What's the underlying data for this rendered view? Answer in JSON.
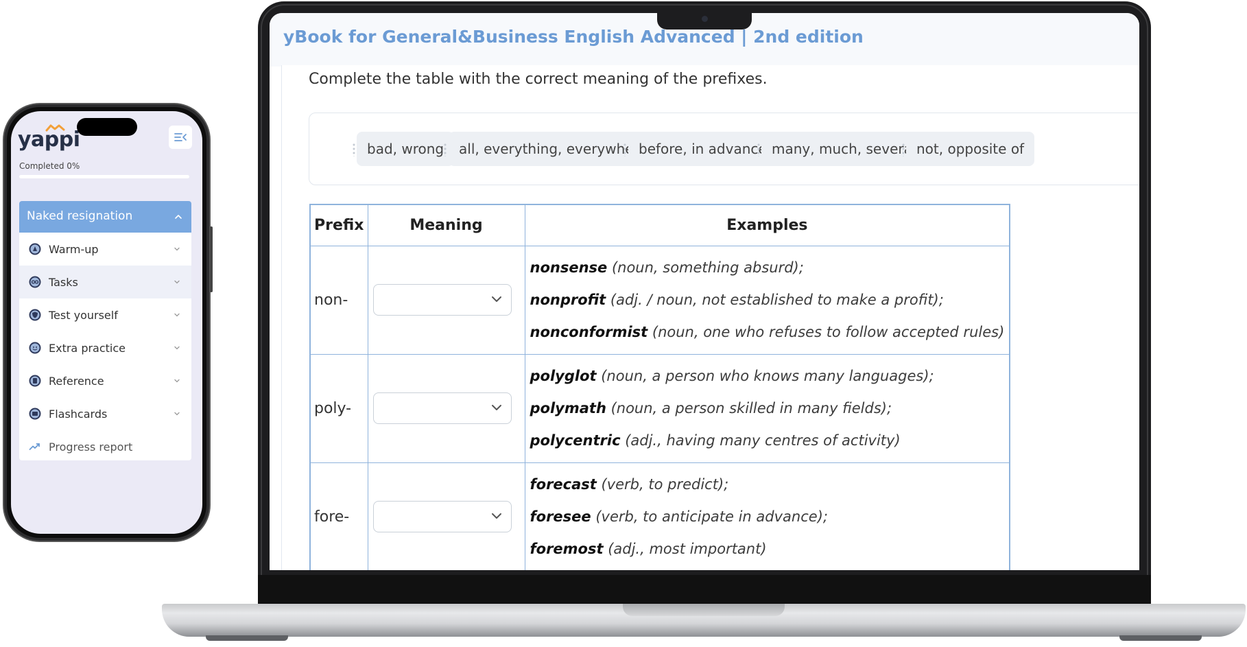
{
  "laptop": {
    "book_title": "yBook for General&Business English Advanced | 2nd edition",
    "instruction": "Complete the table with the correct meaning of the prefixes.",
    "word_bank": [
      "bad, wrong",
      "all, everything, everywhere",
      "before, in advance",
      "many, much, several",
      "not, opposite of"
    ],
    "table": {
      "headers": {
        "prefix": "Prefix",
        "meaning": "Meaning",
        "examples": "Examples"
      },
      "rows": [
        {
          "prefix": "non-",
          "selected_meaning": "",
          "examples": [
            {
              "word": "nonsense",
              "gloss": " (noun, something absurd);"
            },
            {
              "word": "nonprofit",
              "gloss": " (adj. / noun, not established to make a profit);"
            },
            {
              "word": "nonconformist",
              "gloss": " (noun, one who refuses to follow accepted rules)"
            }
          ]
        },
        {
          "prefix": "poly-",
          "selected_meaning": "",
          "examples": [
            {
              "word": "polyglot",
              "gloss": " (noun, a person who knows many languages);"
            },
            {
              "word": "polymath",
              "gloss": " (noun, a person skilled in many fields);"
            },
            {
              "word": "polycentric",
              "gloss": " (adj., having many centres of activity)"
            }
          ]
        },
        {
          "prefix": "fore-",
          "selected_meaning": "",
          "examples": [
            {
              "word": "forecast",
              "gloss": " (verb, to predict);"
            },
            {
              "word": "foresee",
              "gloss": " (verb, to anticipate in advance);"
            },
            {
              "word": "foremost",
              "gloss": " (adj., most important)"
            }
          ]
        }
      ]
    }
  },
  "phone": {
    "logo": "yappi",
    "completed_label": "Completed 0%",
    "progress": 0,
    "unit_title": "Naked resignation",
    "menu": [
      {
        "label": "Warm-up",
        "icon": "lamp-icon"
      },
      {
        "label": "Tasks",
        "icon": "infinity-icon"
      },
      {
        "label": "Test yourself",
        "icon": "shield-icon"
      },
      {
        "label": "Extra practice",
        "icon": "smile-icon"
      },
      {
        "label": "Reference",
        "icon": "book-icon"
      },
      {
        "label": "Flashcards",
        "icon": "cards-icon"
      },
      {
        "label": "Progress report",
        "icon": "trend-icon"
      }
    ]
  },
  "colors": {
    "accent": "#79a8e0",
    "title_blue": "#6b9bd4",
    "table_border": "#8fb3dc",
    "icon_navy": "#2f3a5c"
  }
}
